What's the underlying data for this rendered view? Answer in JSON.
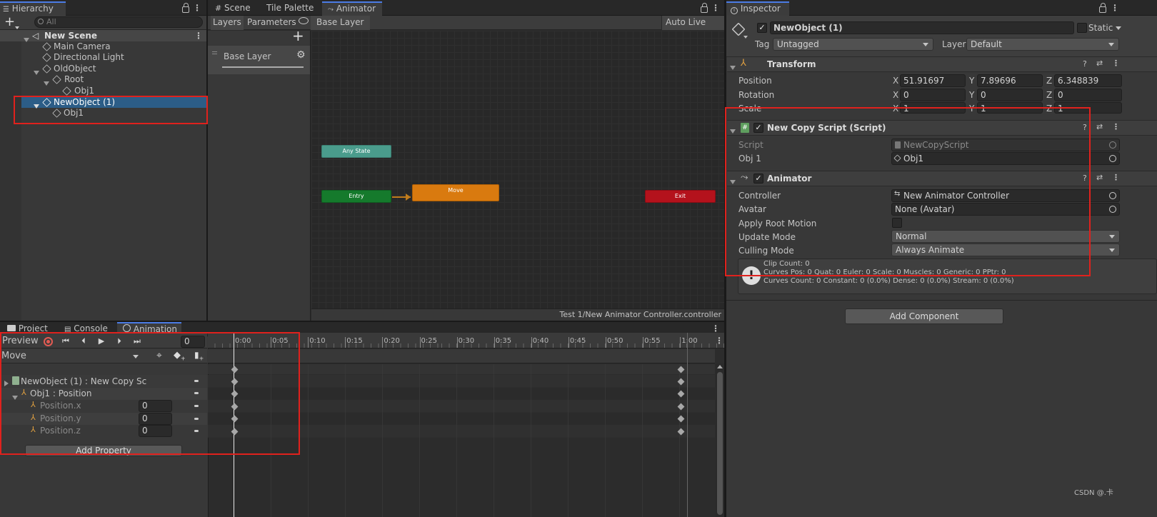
{
  "hierarchy": {
    "tab": "Hierarchy",
    "search_placeholder": "All",
    "items": [
      {
        "label": "New Scene"
      },
      {
        "label": "Main Camera"
      },
      {
        "label": "Directional Light"
      },
      {
        "label": "OldObject"
      },
      {
        "label": "Root"
      },
      {
        "label": "Obj1"
      },
      {
        "label": "NewObject (1)"
      },
      {
        "label": "Obj1"
      }
    ]
  },
  "center_tabs": {
    "scene": "Scene",
    "tile_palette": "Tile Palette",
    "animator": "Animator"
  },
  "animator": {
    "layers_tab": "Layers",
    "parameters_tab": "Parameters",
    "breadcrumb": "Base Layer",
    "auto_live_link": "Auto Live Link",
    "layer_name": "Base Layer",
    "nodes": {
      "any_state": "Any State",
      "entry": "Entry",
      "move": "Move",
      "exit": "Exit"
    },
    "footer_path": "Test 1/New Animator Controller.controller"
  },
  "bottom_tabs": {
    "project": "Project",
    "console": "Console",
    "animation": "Animation"
  },
  "animation": {
    "preview": "Preview",
    "frame": "0",
    "clip": "Move",
    "add_property": "Add Property",
    "ticks": [
      "0:00",
      "0:05",
      "0:10",
      "0:15",
      "0:20",
      "0:25",
      "0:30",
      "0:35",
      "0:40",
      "0:45",
      "0:50",
      "0:55",
      "1:00"
    ],
    "props": [
      {
        "label": "NewObject (1) : New Copy Sc",
        "value": ""
      },
      {
        "label": "Obj1 : Position",
        "value": ""
      },
      {
        "label": "Position.x",
        "value": "0"
      },
      {
        "label": "Position.y",
        "value": "0"
      },
      {
        "label": "Position.z",
        "value": "0"
      }
    ]
  },
  "inspector": {
    "tab": "Inspector",
    "object_name": "NewObject (1)",
    "static_label": "Static",
    "tag_label": "Tag",
    "tag_value": "Untagged",
    "layer_label": "Layer",
    "layer_value": "Default",
    "transform": {
      "title": "Transform",
      "position_label": "Position",
      "rotation_label": "Rotation",
      "scale_label": "Scale",
      "pos": {
        "x": "51.91697",
        "y": "7.89696",
        "z": "6.348839"
      },
      "rot": {
        "x": "0",
        "y": "0",
        "z": "0"
      },
      "scale": {
        "x": "1",
        "y": "1",
        "z": "1"
      }
    },
    "copy_script": {
      "title": "New Copy Script (Script)",
      "script_label": "Script",
      "script_value": "NewCopyScript",
      "obj1_label": "Obj 1",
      "obj1_value": "Obj1"
    },
    "animator": {
      "title": "Animator",
      "controller_label": "Controller",
      "controller_value": "New Animator Controller",
      "avatar_label": "Avatar",
      "avatar_value": "None (Avatar)",
      "root_motion_label": "Apply Root Motion",
      "update_label": "Update Mode",
      "update_value": "Normal",
      "culling_label": "Culling Mode",
      "culling_value": "Always Animate",
      "info_1": "Clip Count: 0",
      "info_2": "Curves Pos: 0 Quat: 0 Euler: 0 Scale: 0 Muscles: 0 Generic: 0 PPtr: 0",
      "info_3": "Curves Count: 0 Constant: 0 (0.0%) Dense: 0 (0.0%) Stream: 0 (0.0%)"
    },
    "add_component": "Add Component"
  },
  "watermark": "CSDN @.卡",
  "colors": {
    "highlight": "#e0211d",
    "selection": "#2c5d87",
    "accent_blue": "#4b7ce6"
  }
}
